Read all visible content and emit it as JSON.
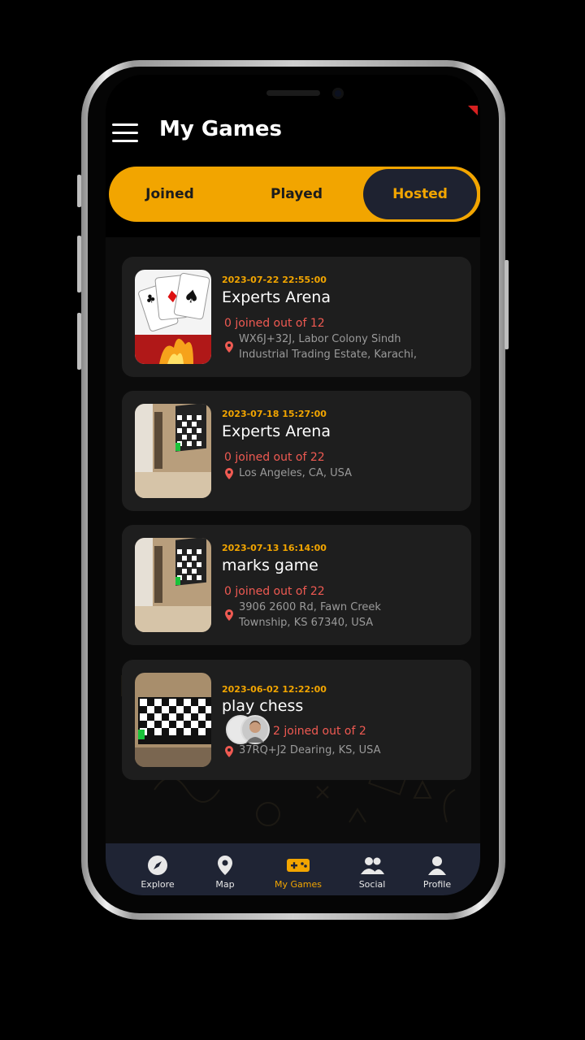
{
  "header": {
    "title": "My Games"
  },
  "tabs": [
    {
      "label": "Joined",
      "active": false
    },
    {
      "label": "Played",
      "active": false
    },
    {
      "label": "Hosted",
      "active": true
    }
  ],
  "games": [
    {
      "date": "2023-07-22 22:55:00",
      "title": "Experts Arena",
      "joined": "0 joined out of 12",
      "location_line1": "WX6J+32J, Labor Colony Sindh",
      "location_line2": "Industrial Trading Estate, Karachi,"
    },
    {
      "date": "2023-07-18 15:27:00",
      "title": "Experts Arena",
      "joined": "0 joined out of 22",
      "location_line1": "Los Angeles, CA, USA",
      "location_line2": ""
    },
    {
      "date": "2023-07-13 16:14:00",
      "title": "marks game",
      "joined": "0 joined out of 22",
      "location_line1": "3906 2600 Rd, Fawn Creek",
      "location_line2": "Township, KS 67340, USA"
    },
    {
      "date": "2023-06-02 12:22:00",
      "title": "play chess",
      "joined": "2 joined out of 2",
      "location_line1": "37RQ+J2 Dearing, KS, USA",
      "location_line2": ""
    }
  ],
  "nav": [
    {
      "label": "Explore",
      "icon": "compass-icon",
      "active": false
    },
    {
      "label": "Map",
      "icon": "map-pin-icon",
      "active": false
    },
    {
      "label": "My Games",
      "icon": "gamepad-icon",
      "active": true
    },
    {
      "label": "Social",
      "icon": "users-icon",
      "active": false
    },
    {
      "label": "Profile",
      "icon": "user-icon",
      "active": false
    }
  ],
  "colors": {
    "accent": "#f2a500",
    "background": "#0c0c0c",
    "card": "#1e1e1e",
    "nav": "#1f2434",
    "joined": "#ef5a52"
  }
}
